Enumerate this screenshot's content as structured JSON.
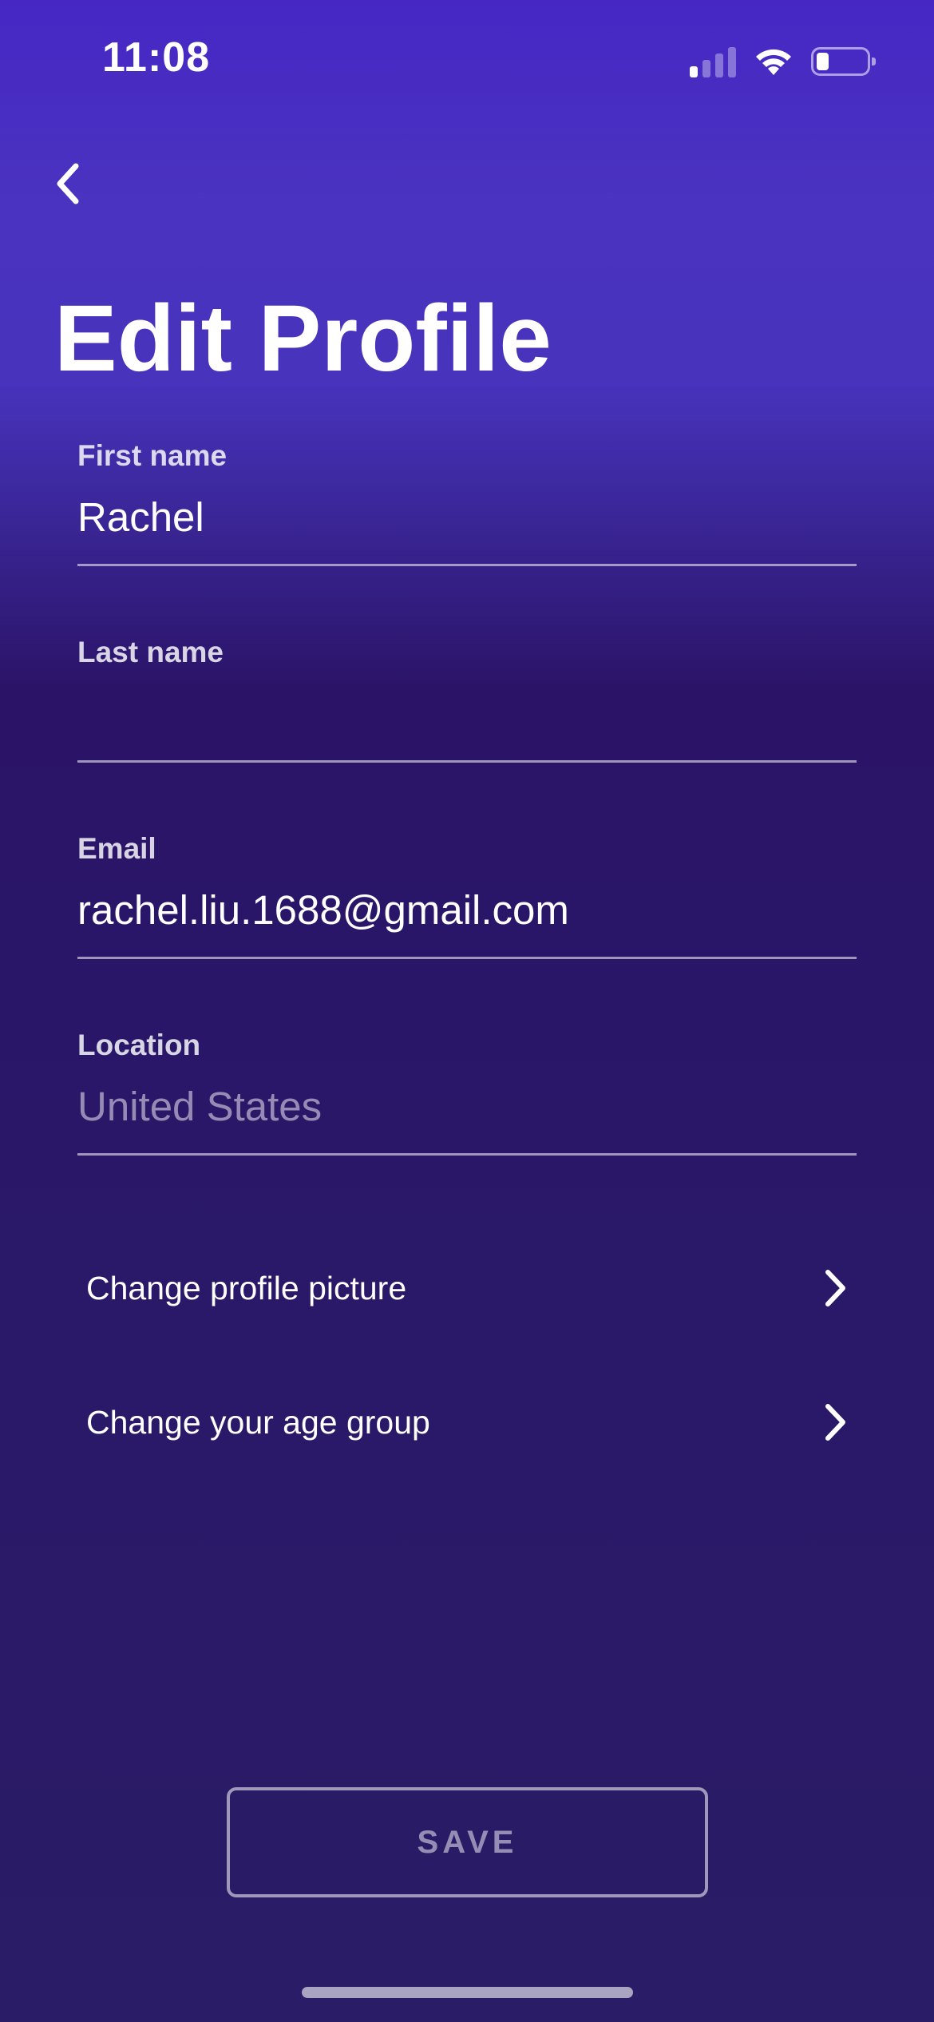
{
  "status_bar": {
    "time": "11:08",
    "signal_bars_active": 1,
    "signal_bars_total": 4,
    "battery_level_fraction": 0.25
  },
  "header": {
    "back_icon": "chevron-left-icon",
    "title": "Edit Profile"
  },
  "form": {
    "first_name": {
      "label": "First name",
      "value": "Rachel",
      "placeholder": ""
    },
    "last_name": {
      "label": "Last name",
      "value": "",
      "placeholder": ""
    },
    "email": {
      "label": "Email",
      "value": "rachel.liu.1688@gmail.com",
      "placeholder": ""
    },
    "location": {
      "label": "Location",
      "value": "",
      "placeholder": "United States"
    }
  },
  "links": [
    {
      "label": "Change profile picture",
      "icon": "chevron-right-icon"
    },
    {
      "label": "Change your age group",
      "icon": "chevron-right-icon"
    }
  ],
  "save_button": {
    "label": "SAVE",
    "enabled": false
  },
  "colors": {
    "background_top": "#4627c4",
    "background_bottom": "#2a1c66",
    "text": "#ffffff"
  }
}
